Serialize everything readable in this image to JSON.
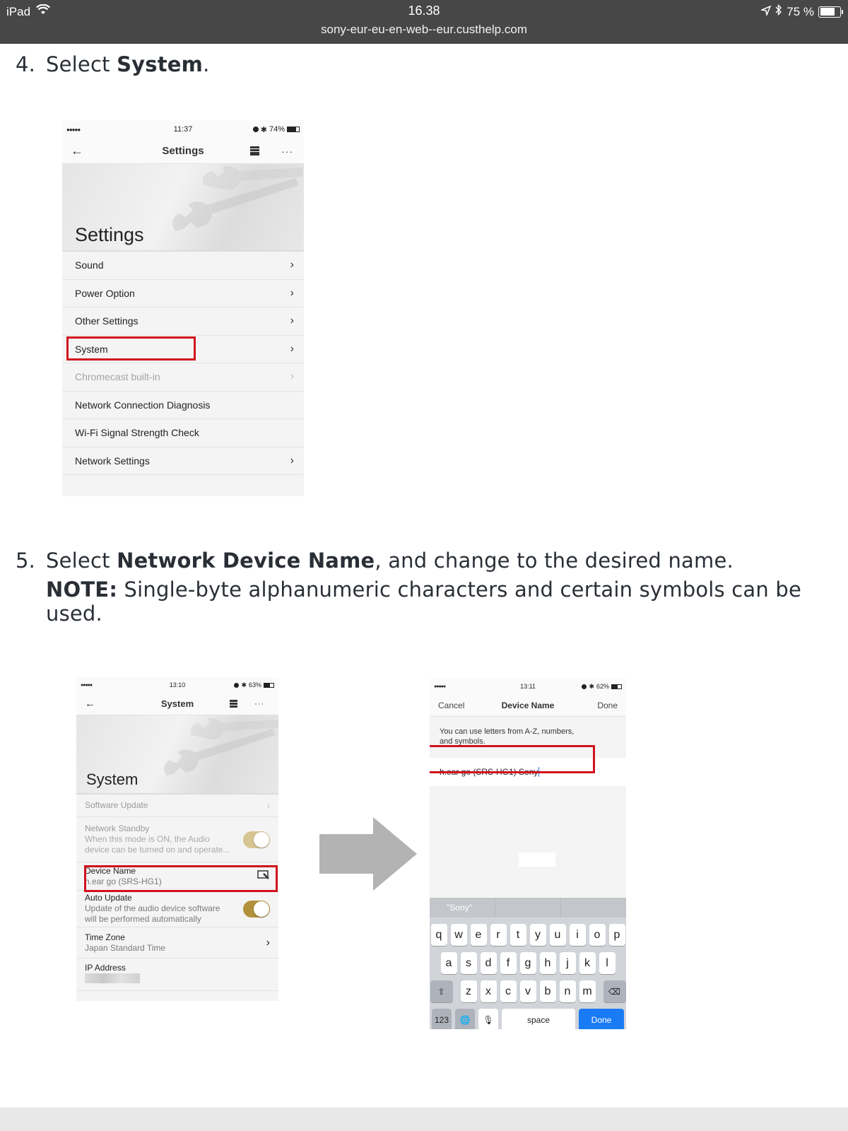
{
  "status_bar": {
    "device": "iPad",
    "time": "16.38",
    "url": "sony-eur-eu-en-web--eur.custhelp.com",
    "battery": "75 %",
    "battery_level": 0.75
  },
  "step4": {
    "number": "4.",
    "prefix": "Select ",
    "bold": "System",
    "suffix": "."
  },
  "step5": {
    "number": "5.",
    "prefix": "Select ",
    "bold": "Network Device Name",
    "suffix": ", and change to the desired name.",
    "note_label": "NOTE:",
    "note_text": " Single-byte alphanumeric characters and certain symbols can be used."
  },
  "settings_screen": {
    "status": {
      "signal": "●●●●●",
      "time": "11:37",
      "battery": "74%"
    },
    "nav_title": "Settings",
    "hero_title": "Settings",
    "items": [
      {
        "label": "Sound",
        "chevron": true,
        "dim": false
      },
      {
        "label": "Power Option",
        "chevron": true,
        "dim": false
      },
      {
        "label": "Other Settings",
        "chevron": true,
        "dim": false
      },
      {
        "label": "System",
        "chevron": true,
        "dim": false,
        "highlighted": true
      },
      {
        "label": "Chromecast built-in",
        "chevron": true,
        "dim": true
      },
      {
        "label": "Network Connection Diagnosis",
        "chevron": false,
        "dim": false
      },
      {
        "label": "Wi-Fi Signal Strength Check",
        "chevron": false,
        "dim": false
      },
      {
        "label": "Network Settings",
        "chevron": true,
        "dim": false
      }
    ]
  },
  "system_screen": {
    "status": {
      "signal": "●●●●●",
      "time": "13:10",
      "battery": "63%"
    },
    "nav_title": "System",
    "hero_title": "System",
    "software_update": "Software Update",
    "network_standby": {
      "title": "Network Standby",
      "desc1": "When this mode is ON, the Audio",
      "desc2": "device can be turned on and operate..."
    },
    "device_name": {
      "title": "Device Name",
      "value": "h.ear go (SRS-HG1)"
    },
    "auto_update": {
      "title": "Auto Update",
      "desc1": "Update of the audio device software",
      "desc2": "will be performed automatically"
    },
    "time_zone": {
      "title": "Time Zone",
      "value": "Japan Standard Time"
    },
    "ip_address": {
      "title": "IP Address"
    }
  },
  "device_name_screen": {
    "status": {
      "signal": "●●●●●",
      "time": "13:11",
      "battery": "62%"
    },
    "cancel": "Cancel",
    "title": "Device Name",
    "done": "Done",
    "hint": "You can use letters from A-Z, numbers, and symbols.",
    "input_value": "h.ear go (SRS-HG1) Sony",
    "suggestion": "\"Sony\"",
    "keyboard": {
      "row1": [
        "q",
        "w",
        "e",
        "r",
        "t",
        "y",
        "u",
        "i",
        "o",
        "p"
      ],
      "row2": [
        "a",
        "s",
        "d",
        "f",
        "g",
        "h",
        "j",
        "k",
        "l"
      ],
      "row3": [
        "z",
        "x",
        "c",
        "v",
        "b",
        "n",
        "m"
      ],
      "numbers": "123",
      "space": "space",
      "done": "Done"
    }
  },
  "colors": {
    "highlight": "#d1121d",
    "toggle_on": "#b3913c",
    "toggle_dim": "#d6c593",
    "keyboard_done": "#1a7cf5"
  }
}
